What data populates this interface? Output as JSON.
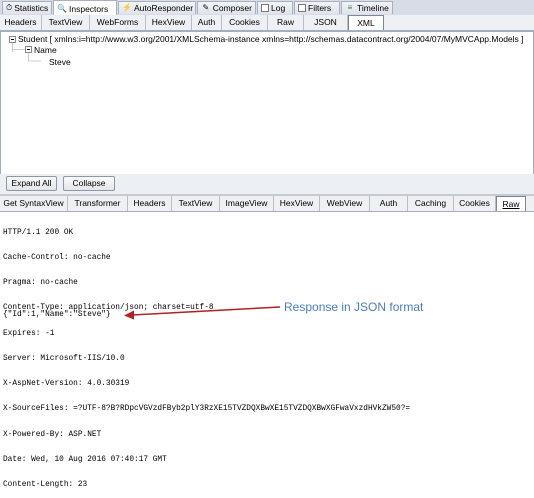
{
  "top_tabs": [
    {
      "label": "Statistics",
      "icon": "stopwatch-icon"
    },
    {
      "label": "Inspectors",
      "icon": "magnifier-icon"
    },
    {
      "label": "AutoResponder",
      "icon": "lightning-icon"
    },
    {
      "label": "Composer",
      "icon": "pencil-icon"
    },
    {
      "label": "Log",
      "icon": "checkbox-icon"
    },
    {
      "label": "Filters",
      "icon": "checkbox-icon"
    },
    {
      "label": "Timeline",
      "icon": "timeline-icon"
    }
  ],
  "request_tabs": [
    "Headers",
    "TextView",
    "WebForms",
    "HexView",
    "Auth",
    "Cookies",
    "Raw",
    "JSON",
    "XML"
  ],
  "request_active_tab": "XML",
  "xml_tree": {
    "root": "Student [ xmlns:i=http://www.w3.org/2001/XMLSchema-instance xmlns=http://schemas.datacontract.org/2004/07/MyMVCApp.Models ]",
    "child": "Name",
    "leaf": "Steve"
  },
  "buttons": {
    "expand_all": "Expand All",
    "collapse": "Collapse"
  },
  "response_tabs": [
    "Get SyntaxView",
    "Transformer",
    "Headers",
    "TextView",
    "ImageView",
    "HexView",
    "WebView",
    "Auth",
    "Caching",
    "Cookies",
    "Raw"
  ],
  "response_active_tab": "Raw",
  "raw_headers": [
    "HTTP/1.1 200 OK",
    "Cache-Control: no-cache",
    "Pragma: no-cache",
    "Content-Type: application/json; charset=utf-8",
    "Expires: -1",
    "Server: Microsoft-IIS/10.0",
    "X-AspNet-Version: 4.0.30319",
    "X-SourceFiles: =?UTF-8?B?RDpcVGVzdFByb2plY3RzXE15TVZDQXBwXE15TVZDQXBwXGFwaVxzdHVkZW50?=",
    "X-Powered-By: ASP.NET",
    "Date: Wed, 10 Aug 2016 07:40:17 GMT",
    "Content-Length: 23"
  ],
  "raw_body": "{\"Id\":1,\"Name\":\"Steve\"}",
  "annotation": "Response in JSON format",
  "colors": {
    "annotation_text": "#4a7cc7",
    "arrow": "#b22222"
  }
}
